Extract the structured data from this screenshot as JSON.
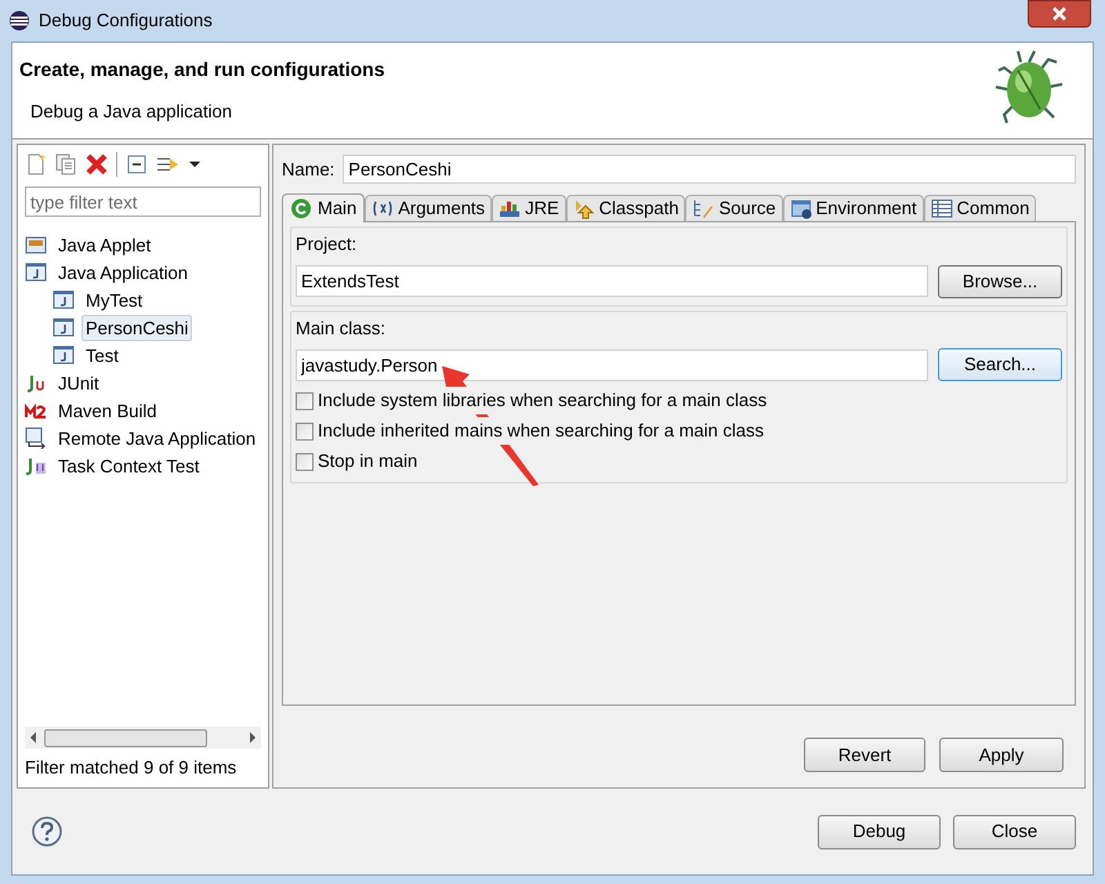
{
  "window": {
    "title": "Debug Configurations"
  },
  "header": {
    "title": "Create, manage, and run configurations",
    "subtitle": "Debug a Java application"
  },
  "filter": {
    "placeholder": "type filter text"
  },
  "tree": [
    {
      "label": "Java Applet",
      "kind": "applet",
      "selected": false
    },
    {
      "label": "Java Application",
      "kind": "java",
      "selected": false,
      "children": [
        {
          "label": "MyTest",
          "kind": "java",
          "selected": false
        },
        {
          "label": "PersonCeshi",
          "kind": "java",
          "selected": true
        },
        {
          "label": "Test",
          "kind": "java",
          "selected": false
        }
      ]
    },
    {
      "label": "JUnit",
      "kind": "junit",
      "selected": false
    },
    {
      "label": "Maven Build",
      "kind": "maven",
      "selected": false
    },
    {
      "label": "Remote Java Application",
      "kind": "remote",
      "selected": false
    },
    {
      "label": "Task Context Test",
      "kind": "task",
      "selected": false
    }
  ],
  "filter_status": "Filter matched 9 of 9 items",
  "name": {
    "label": "Name:",
    "value": "PersonCeshi"
  },
  "tabs": [
    {
      "label": "Main",
      "kind": "main",
      "selected": true
    },
    {
      "label": "Arguments",
      "kind": "args",
      "selected": false
    },
    {
      "label": "JRE",
      "kind": "jre",
      "selected": false
    },
    {
      "label": "Classpath",
      "kind": "classpath",
      "selected": false
    },
    {
      "label": "Source",
      "kind": "source",
      "selected": false
    },
    {
      "label": "Environment",
      "kind": "env",
      "selected": false
    },
    {
      "label": "Common",
      "kind": "common",
      "selected": false
    }
  ],
  "project": {
    "label": "Project:",
    "value": "ExtendsTest",
    "button": "Browse..."
  },
  "main_class": {
    "label": "Main class:",
    "value": "javastudy.Person",
    "button": "Search...",
    "options": [
      {
        "label": "Include system libraries when searching for a main class",
        "checked": false
      },
      {
        "label": "Include inherited mains when searching for a main class",
        "checked": false
      },
      {
        "label": "Stop in main",
        "checked": false
      }
    ]
  },
  "panel_buttons": [
    "Revert",
    "Apply"
  ],
  "dialog_buttons": [
    "Debug",
    "Close"
  ]
}
